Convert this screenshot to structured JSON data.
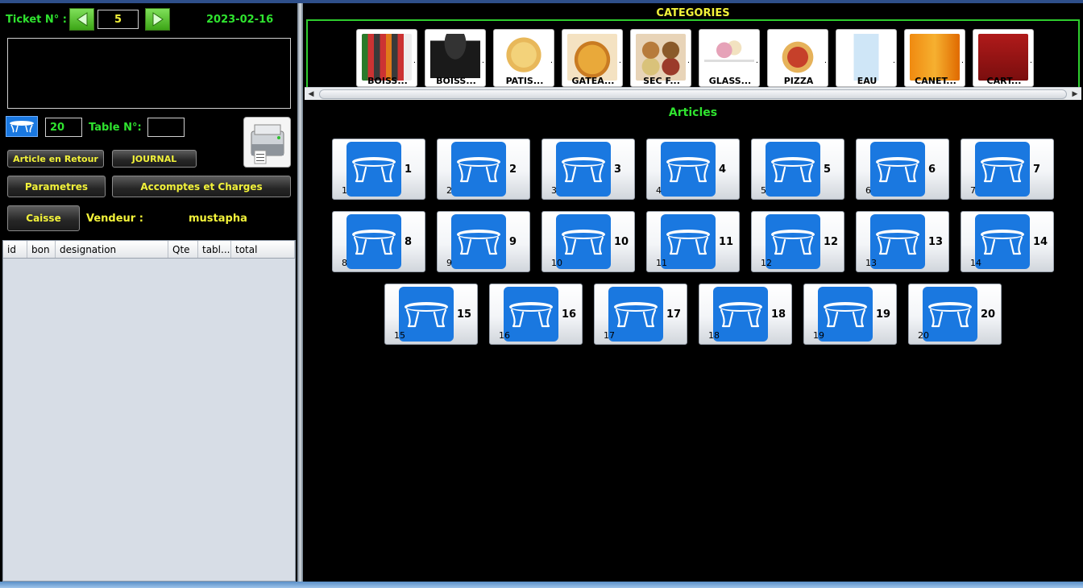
{
  "header": {
    "ticket_label": "Ticket N° :",
    "ticket_number": "5",
    "date": "2023-02-16"
  },
  "table_info": {
    "count": "20",
    "table_label": "Table N°:",
    "table_value": ""
  },
  "buttons": {
    "article_retour": "Article en Retour",
    "journal": "JOURNAL",
    "parametres": "Parametres",
    "accomptes": "Accomptes et Charges",
    "caisse": "Caisse"
  },
  "vendeur": {
    "label": "Vendeur :",
    "name": "mustapha"
  },
  "grid": {
    "columns": [
      "id",
      "bon",
      "designation",
      "Qte",
      "tabl...",
      "total"
    ]
  },
  "categories": {
    "title": "CATEGORIES",
    "items": [
      {
        "name": "BOISS...",
        "icon": "soda-bottles-image"
      },
      {
        "name": "BOISS...",
        "icon": "coffee-cup-image"
      },
      {
        "name": "PATIS...",
        "icon": "cake-image"
      },
      {
        "name": "GATEA...",
        "icon": "pie-image"
      },
      {
        "name": "SEC F...",
        "icon": "dry-fruits-image"
      },
      {
        "name": "GLASS...",
        "icon": "ice-cream-image"
      },
      {
        "name": "PIZZA",
        "icon": "pizza-image"
      },
      {
        "name": "EAU",
        "icon": "water-bottle-image"
      },
      {
        "name": "CANET...",
        "icon": "fanta-can-image"
      },
      {
        "name": "CART...",
        "icon": "juice-carton-image"
      }
    ]
  },
  "articles": {
    "title": "Articles",
    "tables": [
      {
        "num": "1",
        "sub": "1"
      },
      {
        "num": "2",
        "sub": "2"
      },
      {
        "num": "3",
        "sub": "3"
      },
      {
        "num": "4",
        "sub": "4"
      },
      {
        "num": "5",
        "sub": "5"
      },
      {
        "num": "6",
        "sub": "6"
      },
      {
        "num": "7",
        "sub": "7"
      },
      {
        "num": "8",
        "sub": "8"
      },
      {
        "num": "9",
        "sub": "9"
      },
      {
        "num": "10",
        "sub": "10"
      },
      {
        "num": "11",
        "sub": "11"
      },
      {
        "num": "12",
        "sub": "12"
      },
      {
        "num": "13",
        "sub": "13"
      },
      {
        "num": "14",
        "sub": "14"
      },
      {
        "num": "15",
        "sub": "15"
      },
      {
        "num": "16",
        "sub": "16"
      },
      {
        "num": "17",
        "sub": "17"
      },
      {
        "num": "18",
        "sub": "18"
      },
      {
        "num": "19",
        "sub": "19"
      },
      {
        "num": "20",
        "sub": "20"
      }
    ]
  },
  "colors": {
    "green_label": "#2fe32f",
    "yellow_label": "#f2f23a",
    "table_blue": "#1a78e0"
  }
}
